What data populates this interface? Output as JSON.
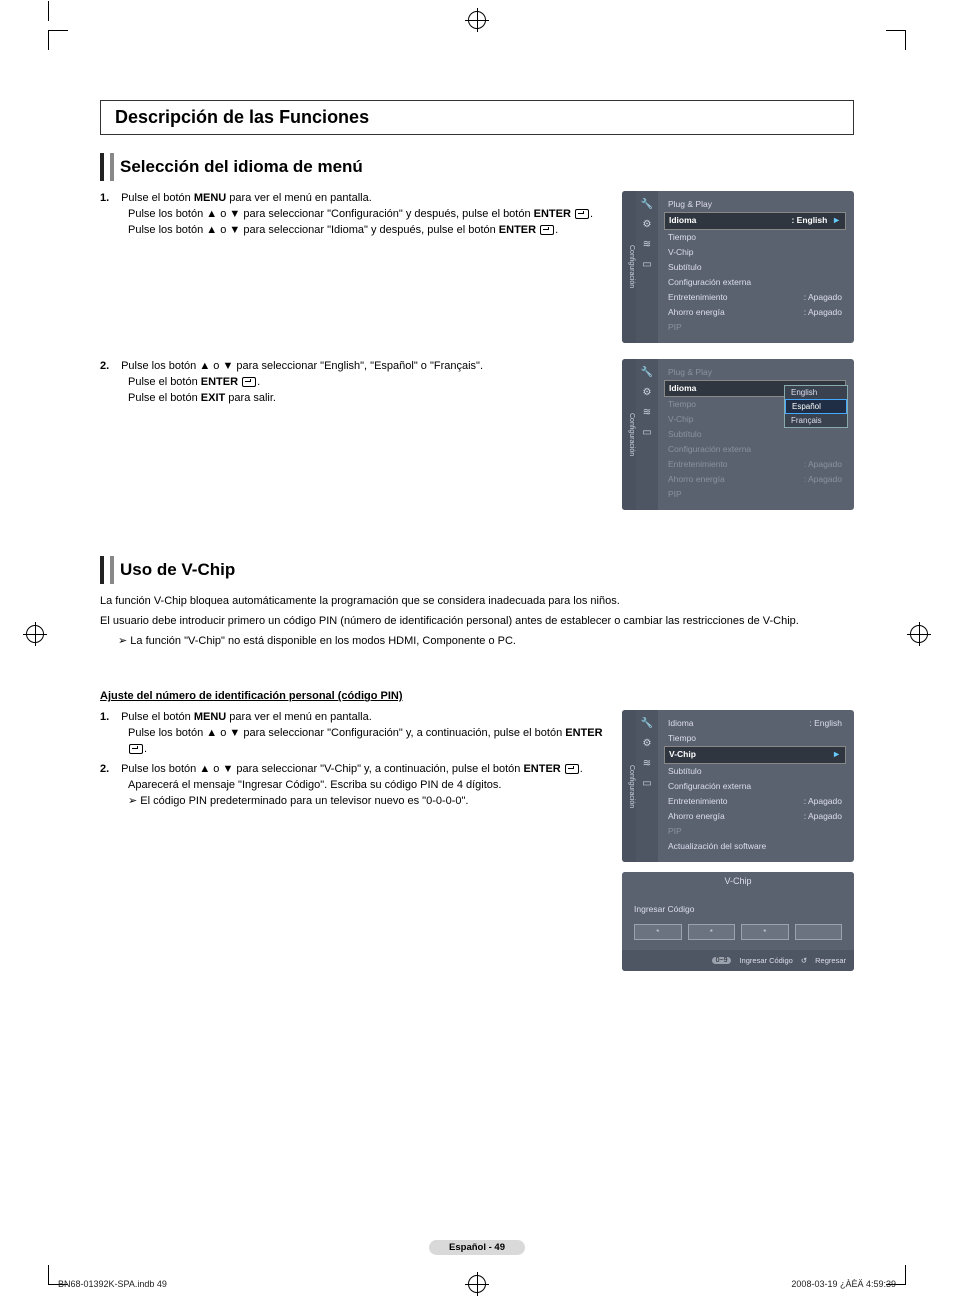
{
  "page": {
    "mainTitle": "Descripción de las Funciones",
    "sectionA": {
      "title": "Selección del idioma de menú",
      "step1_num": "1.",
      "step1_a": "Pulse el botón ",
      "step1_a_bold": "MENU",
      "step1_a_tail": " para ver el menú en pantalla.",
      "step1_b": "Pulse los botón ▲ o ▼ para seleccionar \"Configuración\" y después, pulse el botón ",
      "step1_b_bold": "ENTER",
      "step1_b_tail": ".",
      "step1_c": "Pulse los botón ▲ o ▼ para seleccionar \"Idioma\" y después, pulse el botón ",
      "step1_c_bold": "ENTER",
      "step1_c_tail": ".",
      "step2_num": "2.",
      "step2_a": "Pulse los botón ▲ o ▼ para seleccionar \"English\", \"Español\" o \"Français\".",
      "step2_b_pre": "Pulse el botón ",
      "step2_b_bold": "ENTER",
      "step2_b_tail": ".",
      "step2_c_pre": "Pulse el botón ",
      "step2_c_bold": "EXIT",
      "step2_c_tail": " para salir."
    },
    "osd1": {
      "side": "Configuración",
      "rows": {
        "r0": "Plug & Play",
        "r1_label": "Idioma",
        "r1_value": ": English",
        "r2": "Tiempo",
        "r3": "V-Chip",
        "r4": "Subtítulo",
        "r5": "Configuración externa",
        "r6_label": "Entretenimiento",
        "r6_value": ": Apagado",
        "r7_label": "Ahorro energía",
        "r7_value": ": Apagado",
        "r8": "PIP"
      },
      "arrow": "►"
    },
    "osd2": {
      "side": "Configuración",
      "hl": "Idioma",
      "dropdown": {
        "a": "English",
        "b": "Español",
        "c": "Français"
      },
      "rows": {
        "r0": "Plug & Play",
        "r2": "Tiempo",
        "r3": "V-Chip",
        "r4": "Subtítulo",
        "r5": "Configuración externa",
        "r6_label": "Entretenimiento",
        "r6_value": ": Apagado",
        "r7_label": "Ahorro energía",
        "r7_value": ": Apagado",
        "r8": "PIP"
      }
    },
    "sectionB": {
      "title": "Uso de V-Chip",
      "intro1": "La función V-Chip bloquea automáticamente la programación que se considera inadecuada para los niños.",
      "intro2": "El usuario debe introducir primero un código PIN (número de identificación personal) antes de establecer o cambiar las restricciones de V-Chip.",
      "note": "La función \"V-Chip\" no está disponible en los modos HDMI, Componente o PC.",
      "subhead": "Ajuste del número de identificación personal (código PIN)",
      "s1_num": "1.",
      "s1_a_pre": "Pulse el botón ",
      "s1_a_bold": "MENU",
      "s1_a_tail": " para ver el menú en pantalla.",
      "s1_b": "Pulse los botón ▲ o ▼ para seleccionar \"Configuración\" y, a continuación, pulse el botón ",
      "s1_b_bold": "ENTER",
      "s1_b_tail": ".",
      "s2_num": "2.",
      "s2_a": "Pulse los botón ▲ o ▼ para seleccionar \"V-Chip\" y, a continuación, pulse el botón ",
      "s2_a_bold": "ENTER",
      "s2_a_tail": ".",
      "s2_b": "Aparecerá el mensaje \"Ingresar Código\". Escriba su código PIN de 4 dígitos.",
      "s2_note": "El código PIN predeterminado para un televisor nuevo es \"0-0-0-0\"."
    },
    "osd3": {
      "side": "Configuración",
      "rows": {
        "r0_label": "Idioma",
        "r0_value": ": English",
        "r1": "Tiempo",
        "r2": "V-Chip",
        "r3": "Subtítulo",
        "r4": "Configuración externa",
        "r5_label": "Entretenimiento",
        "r5_value": ": Apagado",
        "r6_label": "Ahorro energía",
        "r6_value": ": Apagado",
        "r7": "PIP",
        "r8": "Actualización del software"
      },
      "arrow": "►"
    },
    "osd_pin": {
      "title": "V-Chip",
      "prompt": "Ingresar Código",
      "slot": "*",
      "pill": "0~9",
      "f1": "Ingresar Código",
      "f2_icon": "↺",
      "f2": "Regresar"
    },
    "footer": {
      "center": "Español - 49",
      "left": "BN68-01392K-SPA.indb   49",
      "right": "2008-03-19   ¿ÀÈÄ 4:59:39"
    }
  }
}
